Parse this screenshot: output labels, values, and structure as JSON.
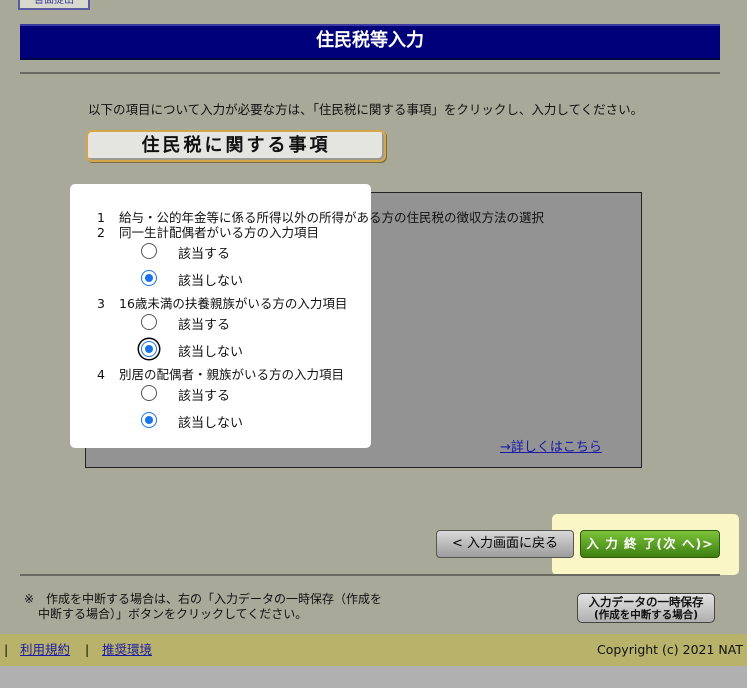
{
  "header": {
    "top_tab_label": "書面提出",
    "title": "住民税等入力"
  },
  "instruction": "以下の項目について入力が必要な方は、「住民税に関する事項」をクリックし、入力してください。",
  "section_title": "住民税に関する事項",
  "items": [
    {
      "num": "1",
      "label": "給与・公的年金等に係る所得以外の所得がある方の住民税の徴収方法の選択"
    },
    {
      "num": "2",
      "label": "同一生計配偶者がいる方の入力項目"
    },
    {
      "num": "3",
      "label": "16歳未満の扶養親族がいる方の入力項目"
    },
    {
      "num": "4",
      "label": "別居の配偶者・親族がいる方の入力項目"
    }
  ],
  "options": {
    "applicable": "該当する",
    "not_applicable": "該当しない"
  },
  "selected": {
    "item2": "not_applicable",
    "item3": "not_applicable",
    "item4": "not_applicable"
  },
  "detail_link": "→詳しくはこちら",
  "buttons": {
    "back": "< 入力画面に戻る",
    "next": "入 力 終 了(次 へ)>",
    "save_line1": "入力データの一時保存",
    "save_line2": "(作成を中断する場合)"
  },
  "note": {
    "line1": "※　作成を中断する場合は、右の「入力データの一時保存（作成を",
    "line2": "中断する場合）」ボタンをクリックしてください。"
  },
  "footer": {
    "terms": "利用規約",
    "environment": "推奨環境",
    "copyright": "Copyright (c) 2021 NAT"
  },
  "colors": {
    "title_bar": "#00007a",
    "next_button": "#5aa025",
    "radio_checked": "#1a73e8",
    "footer": "#b8b26a"
  }
}
